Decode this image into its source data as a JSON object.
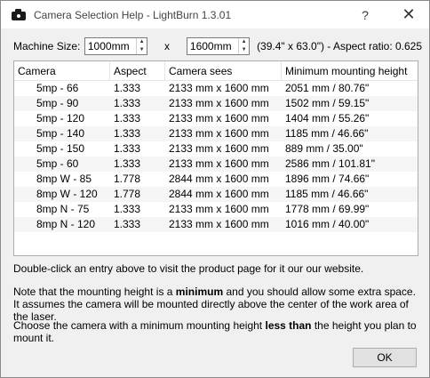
{
  "window": {
    "title": "Camera Selection Help - LightBurn 1.3.01",
    "help_glyph": "?",
    "close_glyph": "✕"
  },
  "machine": {
    "label": "Machine Size:",
    "width_value": "1000mm",
    "height_value": "1600mm",
    "separator": "x",
    "ratio_text": "(39.4\" x 63.0\") - Aspect ratio: 0.625"
  },
  "table": {
    "headers": [
      "Camera",
      "Aspect",
      "Camera sees",
      "Minimum mounting height"
    ],
    "rows": [
      [
        "5mp - 66",
        "1.333",
        "2133 mm x 1600 mm",
        "2051 mm / 80.76\""
      ],
      [
        "5mp - 90",
        "1.333",
        "2133 mm x 1600 mm",
        "1502 mm / 59.15\""
      ],
      [
        "5mp - 120",
        "1.333",
        "2133 mm x 1600 mm",
        "1404 mm / 55.26\""
      ],
      [
        "5mp - 140",
        "1.333",
        "2133 mm x 1600 mm",
        "1185 mm / 46.66\""
      ],
      [
        "5mp - 150",
        "1.333",
        "2133 mm x 1600 mm",
        "889 mm / 35.00\""
      ],
      [
        "5mp - 60",
        "1.333",
        "2133 mm x 1600 mm",
        "2586 mm / 101.81\""
      ],
      [
        "8mp W - 85",
        "1.778",
        "2844 mm x 1600 mm",
        "1896 mm / 74.66\""
      ],
      [
        "8mp W - 120",
        "1.778",
        "2844 mm x 1600 mm",
        "1185 mm / 46.66\""
      ],
      [
        "8mp N - 75",
        "1.333",
        "2133 mm x 1600 mm",
        "1778 mm / 69.99\""
      ],
      [
        "8mp N - 120",
        "1.333",
        "2133 mm x 1600 mm",
        "1016 mm / 40.00\""
      ]
    ]
  },
  "notes": {
    "p1": "Double-click an entry above to visit the product page for it our our website.",
    "p2_a": "Note that the mounting height is a ",
    "p2_bold": "minimum",
    "p2_b": " and you should allow some extra space. It assumes the camera will be mounted directly above the center of the work area of the laser.",
    "p3_a": "Choose the camera with a minimum mounting height ",
    "p3_bold": "less than",
    "p3_b": " the height you plan to mount it."
  },
  "buttons": {
    "ok": "OK"
  },
  "icons": {
    "app": "camera-icon",
    "spin_up": "▲",
    "spin_down": "▼"
  }
}
